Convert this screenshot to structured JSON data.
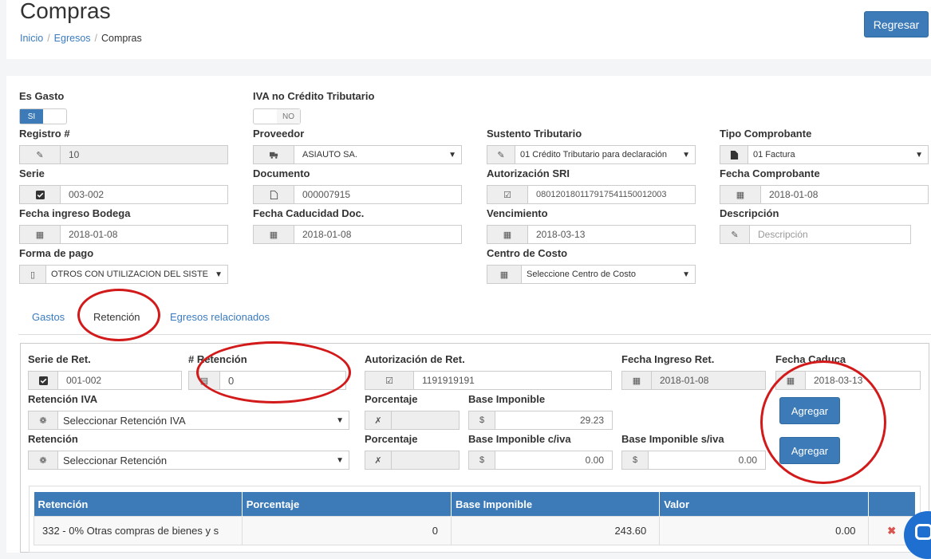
{
  "header": {
    "title": "Compras",
    "breadcrumb": [
      "Inicio",
      "Egresos",
      "Compras"
    ],
    "back_button": "Regresar"
  },
  "form": {
    "es_gasto": {
      "label": "Es Gasto",
      "value": "SI"
    },
    "iva_no_credito": {
      "label": "IVA no Crédito Tributario",
      "value": "NO"
    },
    "registro": {
      "label": "Registro #",
      "value": "10"
    },
    "proveedor": {
      "label": "Proveedor",
      "value": "ASIAUTO SA."
    },
    "sustento": {
      "label": "Sustento Tributario",
      "value": "01 Crédito Tributario para declaración"
    },
    "tipo_comprobante": {
      "label": "Tipo Comprobante",
      "value": "01 Factura"
    },
    "serie": {
      "label": "Serie",
      "value": "003-002"
    },
    "documento": {
      "label": "Documento",
      "value": "000007915"
    },
    "autorizacion_sri": {
      "label": "Autorización SRI",
      "value": "080120180117917541150012003"
    },
    "fecha_comprobante": {
      "label": "Fecha Comprobante",
      "value": "2018-01-08"
    },
    "fecha_ingreso_bodega": {
      "label": "Fecha ingreso Bodega",
      "value": "2018-01-08"
    },
    "fecha_caducidad": {
      "label": "Fecha Caducidad Doc.",
      "value": "2018-01-08"
    },
    "vencimiento": {
      "label": "Vencimiento",
      "value": "2018-03-13"
    },
    "descripcion": {
      "label": "Descripción",
      "placeholder": "Descripción"
    },
    "forma_pago": {
      "label": "Forma de pago",
      "value": "OTROS CON UTILIZACION DEL SISTE"
    },
    "centro_costo": {
      "label": "Centro de Costo",
      "value": "Seleccione Centro de Costo"
    }
  },
  "tabs": [
    "Gastos",
    "Retención",
    "Egresos relacionados"
  ],
  "retencion": {
    "serie": {
      "label": "Serie de Ret.",
      "value": "001-002"
    },
    "numero": {
      "label": "# Retención",
      "value": "0"
    },
    "autorizacion": {
      "label": "Autorización de Ret.",
      "value": "1191919191"
    },
    "fecha_ingreso": {
      "label": "Fecha Ingreso Ret.",
      "value": "2018-01-08"
    },
    "fecha_caduca": {
      "label": "Fecha Caduca",
      "value": "2018-03-13"
    },
    "ret_iva": {
      "label": "Retención IVA",
      "value": "Seleccionar Retención IVA"
    },
    "porcentaje1": {
      "label": "Porcentaje",
      "value": ""
    },
    "base_imponible": {
      "label": "Base Imponible",
      "value": "29.23"
    },
    "ret": {
      "label": "Retención",
      "value": "Seleccionar Retención"
    },
    "porcentaje2": {
      "label": "Porcentaje",
      "value": ""
    },
    "base_civa": {
      "label": "Base Imponible c/iva",
      "value": "0.00"
    },
    "base_siva": {
      "label": "Base Imponible s/iva",
      "value": "0.00"
    },
    "agregar_label": "Agregar",
    "currency": "$"
  },
  "table": {
    "headers": [
      "Retención",
      "Porcentaje",
      "Base Imponible",
      "Valor",
      ""
    ],
    "rows": [
      {
        "retencion": "332 - 0% Otras compras de bienes y s",
        "porcentaje": "0",
        "base": "243.60",
        "valor": "0.00"
      }
    ]
  },
  "colors": {
    "primary": "#3c7ab8",
    "annotation": "#d21a1a",
    "danger": "#d9534f"
  }
}
